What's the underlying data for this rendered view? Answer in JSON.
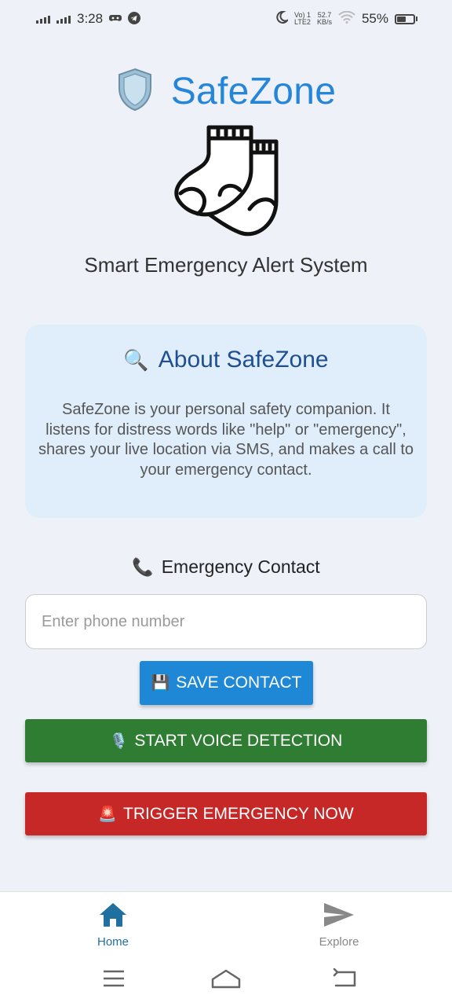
{
  "status_bar": {
    "time": "3:28",
    "network_top": "Vo) 1",
    "network_bottom": "LTE2",
    "speed_top": "52.7",
    "speed_bottom": "KB/s",
    "battery": "55%"
  },
  "header": {
    "app_name": "SafeZone",
    "tagline": "Smart Emergency Alert System"
  },
  "about": {
    "icon": "🔍",
    "title": "About SafeZone",
    "text": "SafeZone is your personal safety companion. It listens for distress words like \"help\" or \"emergency\", shares your live location via SMS, and makes a call to your emergency contact."
  },
  "contact": {
    "icon": "📞",
    "title": "Emergency Contact",
    "input_placeholder": "Enter phone number",
    "input_value": ""
  },
  "buttons": {
    "save_icon": "💾",
    "save_label": "SAVE CONTACT",
    "voice_icon": "🎙️",
    "voice_label": "START VOICE DETECTION",
    "emergency_icon": "🚨",
    "emergency_label": "TRIGGER EMERGENCY NOW"
  },
  "bottom_nav": {
    "items": [
      {
        "label": "Home",
        "icon": "home-icon",
        "active": true
      },
      {
        "label": "Explore",
        "icon": "send-icon",
        "active": false
      }
    ]
  },
  "colors": {
    "background": "#eef2f8",
    "brand": "#2585d8",
    "save_button": "#1f88d6",
    "voice_button": "#2e7d32",
    "emergency_button": "#c62828",
    "about_card": "#e0eefc",
    "about_title": "#1f4f92",
    "nav_active": "#1f6fa0"
  }
}
